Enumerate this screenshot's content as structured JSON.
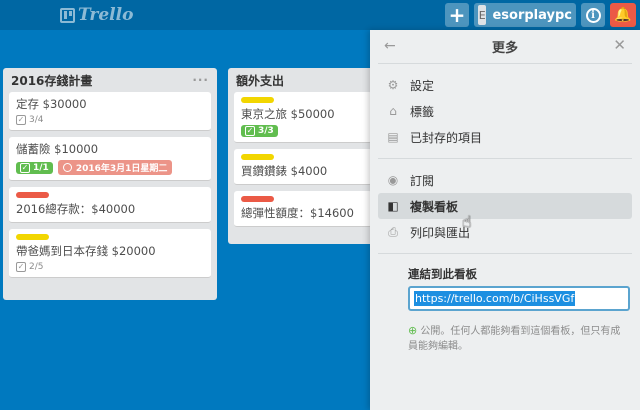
{
  "topbar": {
    "logo_text": "Trello",
    "add_icon": "+",
    "avatar_initial": "E",
    "username": "esorplaypc",
    "info_icon": "i",
    "bell_icon": "bell-icon"
  },
  "lists": [
    {
      "title": "2016存錢計畫",
      "menu": "···",
      "cards": [
        {
          "title": "定存 $30000",
          "checklist": "3/4"
        },
        {
          "title": "儲蓄險 $10000",
          "checklist": "1/1",
          "due": "2016年3月1日星期二"
        },
        {
          "title": "2016總存款：$40000",
          "label_color": "#eb5a46"
        },
        {
          "title": "帶爸媽到日本存錢 $20000",
          "label_color": "#f2d600",
          "checklist": "2/5"
        }
      ]
    },
    {
      "title": "額外支出",
      "cards": [
        {
          "title": "東京之旅 $50000",
          "label_color": "#f2d600",
          "checklist": "3/3"
        },
        {
          "title": "買鑽鑽錶 $4000",
          "label_color": "#f2d600"
        },
        {
          "title": "總彈性額度：$14600",
          "label_color": "#eb5a46"
        }
      ]
    }
  ],
  "panel": {
    "title": "更多",
    "section1": [
      {
        "label": "設定",
        "icon": "gear-icon"
      },
      {
        "label": "標籤",
        "icon": "tag-icon"
      },
      {
        "label": "已封存的項目",
        "icon": "archive-icon"
      }
    ],
    "section2": [
      {
        "label": "訂閱",
        "icon": "eye-icon"
      },
      {
        "label": "複製看板",
        "icon": "copy-board-icon"
      },
      {
        "label": "列印與匯出",
        "icon": "print-icon"
      }
    ],
    "link_label": "連結到此看板",
    "link_value": "https://trello.com/b/CiHssVGf",
    "note": "公開。任何人都能夠看到這個看板，但只有成員能夠編輯。"
  },
  "colors": {
    "board_bg": "#0079bf",
    "topbar_bg": "#0067a3",
    "label_red": "#eb5a46",
    "label_yellow": "#f2d600",
    "badge_green": "#61bd4f"
  }
}
